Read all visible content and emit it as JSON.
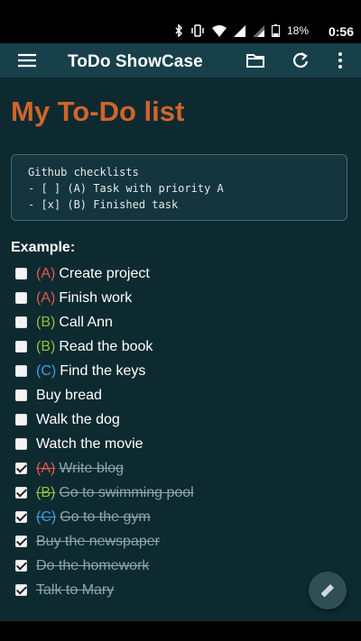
{
  "status": {
    "battery": "18%",
    "time": "0:56"
  },
  "appbar": {
    "title": "ToDo ShowCase",
    "icons": [
      "menu-icon",
      "folder-icon",
      "refresh-icon",
      "more-vert-icon"
    ]
  },
  "main": {
    "title": "My To-Do list",
    "code_lines": [
      "Github checklists",
      "- [ ] (A) Task with priority A",
      "- [x] (B) Finished task"
    ],
    "example_label": "Example:",
    "tasks": [
      {
        "priority": "(A)",
        "text": "Create project",
        "done": false
      },
      {
        "priority": "(A)",
        "text": "Finish work",
        "done": false
      },
      {
        "priority": "(B)",
        "text": "Call Ann",
        "done": false
      },
      {
        "priority": "(B)",
        "text": "Read the book",
        "done": false
      },
      {
        "priority": "(C)",
        "text": "Find the keys",
        "done": false
      },
      {
        "priority": "",
        "text": "Buy bread",
        "done": false
      },
      {
        "priority": "",
        "text": "Walk the dog",
        "done": false
      },
      {
        "priority": "",
        "text": "Watch the movie",
        "done": false
      },
      {
        "priority": "(A)",
        "text": "Write blog",
        "done": true
      },
      {
        "priority": "(B)",
        "text": "Go to swimming pool",
        "done": true
      },
      {
        "priority": "(C)",
        "text": "Go to the gym",
        "done": true
      },
      {
        "priority": "",
        "text": "Buy the newspaper",
        "done": true
      },
      {
        "priority": "",
        "text": "Do the homework",
        "done": true
      },
      {
        "priority": "",
        "text": "Talk to Mary",
        "done": true
      }
    ]
  },
  "colors": {
    "priority_a": "#e0594e",
    "priority_b": "#8fbf3a",
    "priority_c": "#3c9ee0",
    "title": "#d2642a",
    "appbar": "#18404a",
    "background": "#0e2a31"
  },
  "fab": {
    "icon": "edit-pencil-icon"
  }
}
